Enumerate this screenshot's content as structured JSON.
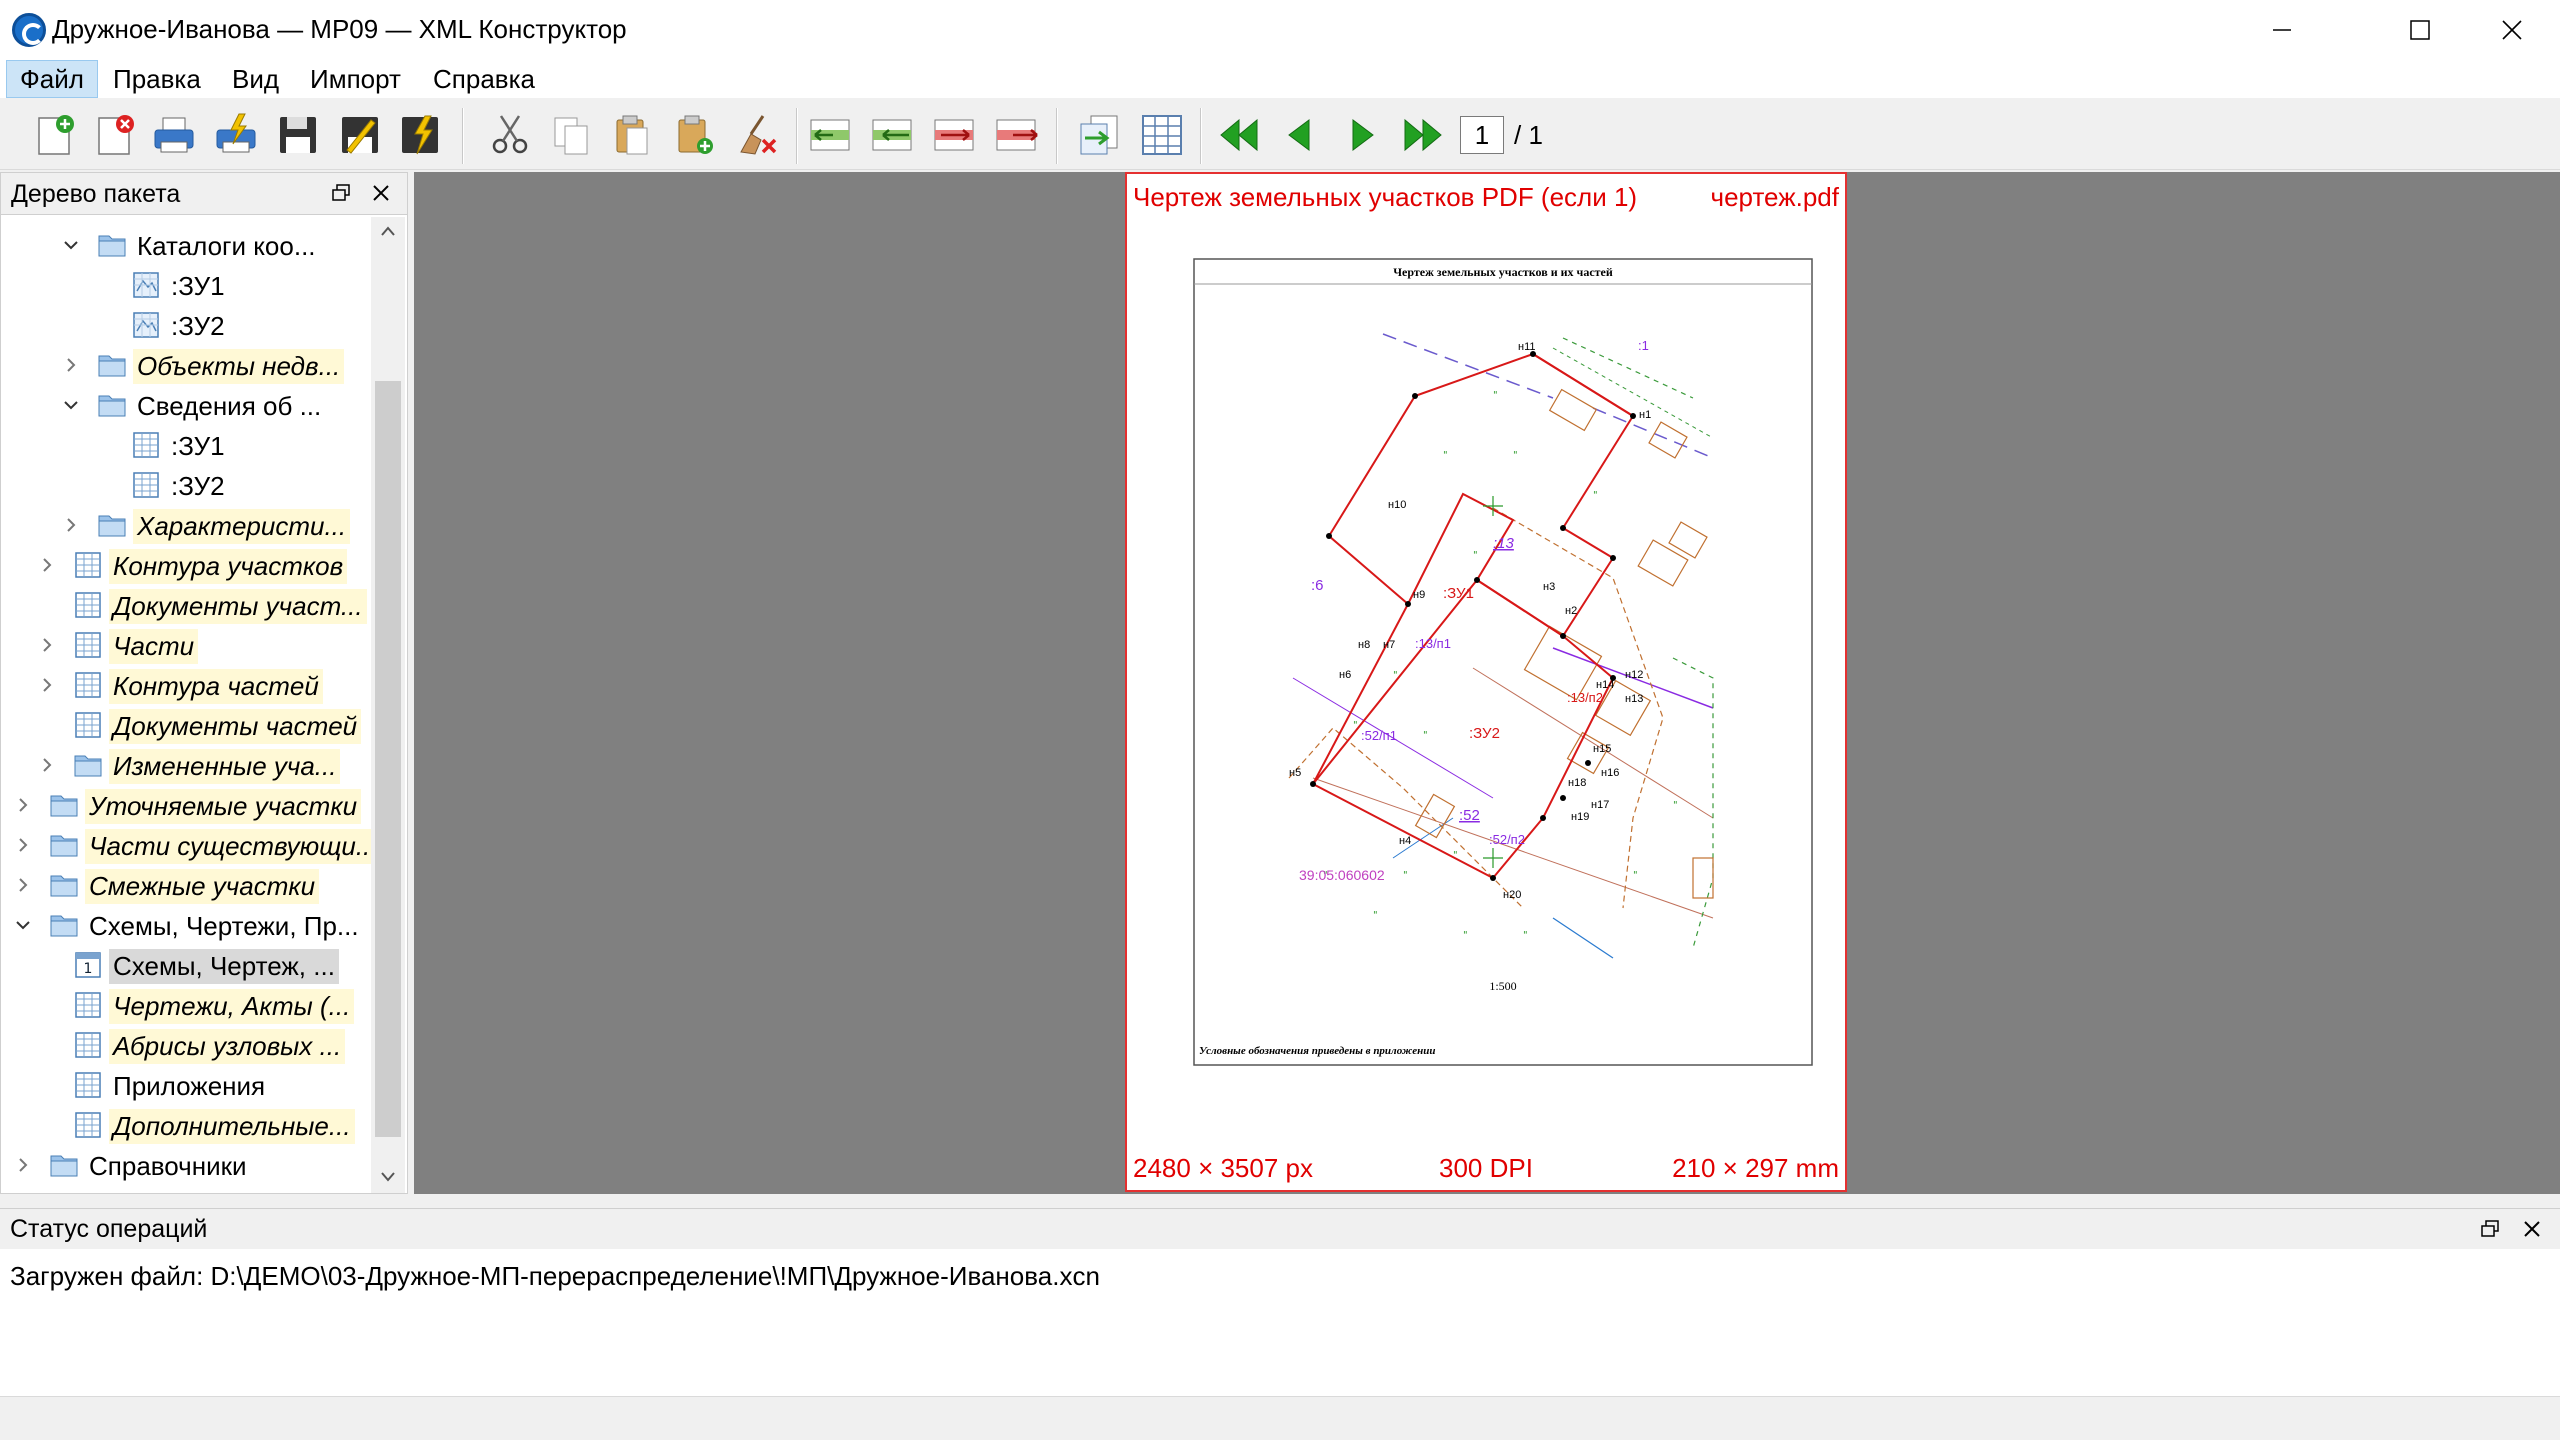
{
  "window": {
    "title": "Дружное-Иванова — МР09 — XML Конструктор"
  },
  "menu": [
    "Файл",
    "Правка",
    "Вид",
    "Импорт",
    "Справка"
  ],
  "toolbar": {
    "icons": [
      "new-file-icon",
      "close-file-icon",
      "print-icon",
      "quick-print-icon",
      "save-icon",
      "sign-icon",
      "quick-sign-icon",
      "cut-icon",
      "copy-icon",
      "paste-icon",
      "paste-special-icon",
      "clear-icon",
      "row-insert-left-icon",
      "row-insert-icon",
      "row-move-icon",
      "row-delete-icon",
      "export-icon",
      "table-icon",
      "first-page-icon",
      "prev-page-icon",
      "next-page-icon",
      "last-page-icon"
    ],
    "page_current": "1",
    "page_total": "/ 1"
  },
  "tree": {
    "title": "Дерево пакета",
    "items": [
      {
        "label": "Каталоги коо...",
        "level": 2,
        "expander": "open",
        "icon": "folder",
        "italic": false
      },
      {
        "label": ":ЗУ1",
        "level": 3,
        "expander": "none",
        "icon": "map",
        "italic": false
      },
      {
        "label": ":ЗУ2",
        "level": 3,
        "expander": "none",
        "icon": "map",
        "italic": false
      },
      {
        "label": "Объекты недв...",
        "level": 2,
        "expander": "closed",
        "icon": "folder",
        "italic": true
      },
      {
        "label": "Сведения об ...",
        "level": 2,
        "expander": "open",
        "icon": "folder",
        "italic": false
      },
      {
        "label": ":ЗУ1",
        "level": 3,
        "expander": "none",
        "icon": "table",
        "italic": false
      },
      {
        "label": ":ЗУ2",
        "level": 3,
        "expander": "none",
        "icon": "table",
        "italic": false
      },
      {
        "label": "Характеристи...",
        "level": 2,
        "expander": "closed",
        "icon": "folder",
        "italic": true
      },
      {
        "label": "Контура участков",
        "level": 1,
        "expander": "closed",
        "icon": "table",
        "italic": true
      },
      {
        "label": "Документы участ...",
        "level": 1,
        "expander": "none",
        "icon": "table",
        "italic": true
      },
      {
        "label": "Части",
        "level": 1,
        "expander": "closed",
        "icon": "table",
        "italic": true
      },
      {
        "label": "Контура частей",
        "level": 1,
        "expander": "closed",
        "icon": "table",
        "italic": true
      },
      {
        "label": "Документы частей",
        "level": 1,
        "expander": "none",
        "icon": "table",
        "italic": true
      },
      {
        "label": "Измененные уча...",
        "level": 1,
        "expander": "closed",
        "icon": "folder",
        "italic": true
      },
      {
        "label": "Уточняемые участки",
        "level": 0,
        "expander": "closed",
        "icon": "folder",
        "italic": true
      },
      {
        "label": "Части существующи...",
        "level": 0,
        "expander": "closed",
        "icon": "folder",
        "italic": true
      },
      {
        "label": "Смежные участки",
        "level": 0,
        "expander": "closed",
        "icon": "folder",
        "italic": true
      },
      {
        "label": "Схемы, Чертежи, Пр...",
        "level": 0,
        "expander": "open",
        "icon": "folder",
        "italic": false
      },
      {
        "label": "Схемы, Чертеж, ...",
        "level": 1,
        "expander": "none",
        "icon": "numbered",
        "italic": false,
        "selected": true
      },
      {
        "label": "Чертежи, Акты (...",
        "level": 1,
        "expander": "none",
        "icon": "table",
        "italic": true
      },
      {
        "label": "Абрисы узловых ...",
        "level": 1,
        "expander": "none",
        "icon": "table",
        "italic": true
      },
      {
        "label": "Приложения",
        "level": 1,
        "expander": "none",
        "icon": "table",
        "italic": false
      },
      {
        "label": "Дополнительные...",
        "level": 1,
        "expander": "none",
        "icon": "table",
        "italic": true
      },
      {
        "label": "Справочники",
        "level": 0,
        "expander": "closed",
        "icon": "folder",
        "italic": false
      }
    ]
  },
  "viewer": {
    "doc_title": "Чертеж земельных участков PDF (если 1)",
    "file_name": "чертеж.pdf",
    "size_px": "2480 × 3507 px",
    "dpi": "300 DPI",
    "size_mm": "210 × 297 mm",
    "drawing": {
      "heading": "Чертеж земельных участков и их частей",
      "scale": "1:500",
      "legend_note": "Условные обозначения приведены в приложении",
      "labels": [
        "н11",
        ":1",
        "н1",
        "н10",
        ":13",
        "н9",
        "н3",
        ":ЗУ1",
        "н2",
        ":6",
        "н8",
        "н7",
        ":13/п1",
        "н6",
        "н14",
        "н12",
        "н13",
        ":13/п2",
        ":52/п1",
        ":ЗУ2",
        "н15",
        "н16",
        "н5",
        "н18",
        "н17",
        "н19",
        ":52",
        "н4",
        ":52/п2",
        "39:05:060602",
        "н20"
      ]
    }
  },
  "status": {
    "title": "Статус операций",
    "message": "Загружен файл: D:\\ДЕМО\\03-Дружное-МП-перераспределение\\!МП\\Дружное-Иванова.xcn"
  },
  "colors": {
    "accent_red": "#e00000",
    "viewer_bg": "#808080",
    "italic_bg": "#fff9d6",
    "menu_active": "#cce4f7"
  }
}
